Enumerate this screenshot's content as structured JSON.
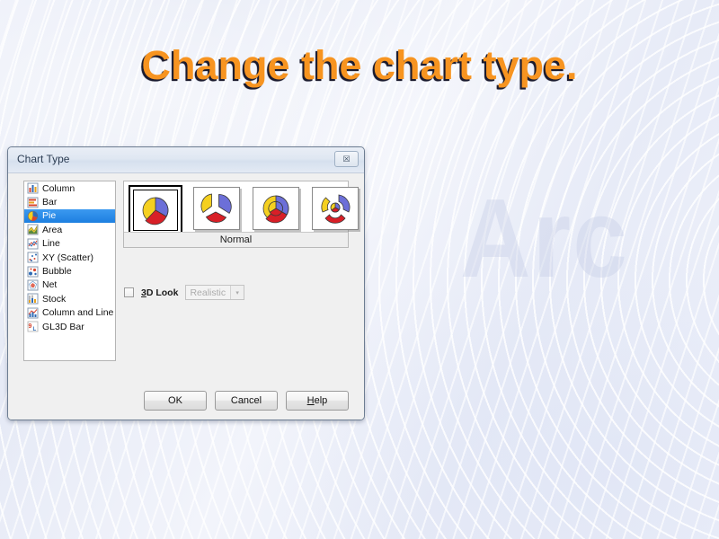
{
  "slide": {
    "title": "Change the chart type.",
    "title_color": "#f79420",
    "title_shadow_color": "#1b1b2e",
    "background_watermark": "Arc"
  },
  "dialog": {
    "title": "Chart Type",
    "close_icon": "close-icon",
    "close_glyph": "☒",
    "chart_types": [
      {
        "label": "Column",
        "icon": "column-chart-icon",
        "selected": false
      },
      {
        "label": "Bar",
        "icon": "bar-chart-icon",
        "selected": false
      },
      {
        "label": "Pie",
        "icon": "pie-chart-icon",
        "selected": true
      },
      {
        "label": "Area",
        "icon": "area-chart-icon",
        "selected": false
      },
      {
        "label": "Line",
        "icon": "line-chart-icon",
        "selected": false
      },
      {
        "label": "XY (Scatter)",
        "icon": "scatter-chart-icon",
        "selected": false
      },
      {
        "label": "Bubble",
        "icon": "bubble-chart-icon",
        "selected": false
      },
      {
        "label": "Net",
        "icon": "net-chart-icon",
        "selected": false
      },
      {
        "label": "Stock",
        "icon": "stock-chart-icon",
        "selected": false
      },
      {
        "label": "Column and Line",
        "icon": "column-line-chart-icon",
        "selected": false
      },
      {
        "label": "GL3D Bar",
        "icon": "gl3d-bar-chart-icon",
        "selected": false
      }
    ],
    "variants": [
      {
        "name": "Normal",
        "icon": "pie-normal-icon",
        "selected": true
      },
      {
        "name": "Exploded Pie",
        "icon": "pie-exploded-icon",
        "selected": false
      },
      {
        "name": "Donut",
        "icon": "pie-donut-icon",
        "selected": false
      },
      {
        "name": "Exploded Donut",
        "icon": "pie-exploded-donut-icon",
        "selected": false
      }
    ],
    "variant_label": "Normal",
    "threed": {
      "checkbox_label_prefix": "",
      "checkbox_label": "3D Look",
      "checkbox_accesskey": "3",
      "checkbox_label_rest": "D Look",
      "checked": false,
      "shading_value": "Realistic",
      "shading_enabled": false,
      "shading_arrow": "▾"
    },
    "buttons": {
      "ok": "OK",
      "cancel": "Cancel",
      "help_accesskey": "H",
      "help_rest": "elp"
    },
    "palette": {
      "slice_yellow": "#f5d020",
      "slice_blue": "#6c6fd8",
      "slice_red": "#d81f27",
      "selection_blue": "#1d7fe0",
      "dialog_face": "#f0f0f0",
      "titlebar": "#dfe7f2"
    }
  }
}
